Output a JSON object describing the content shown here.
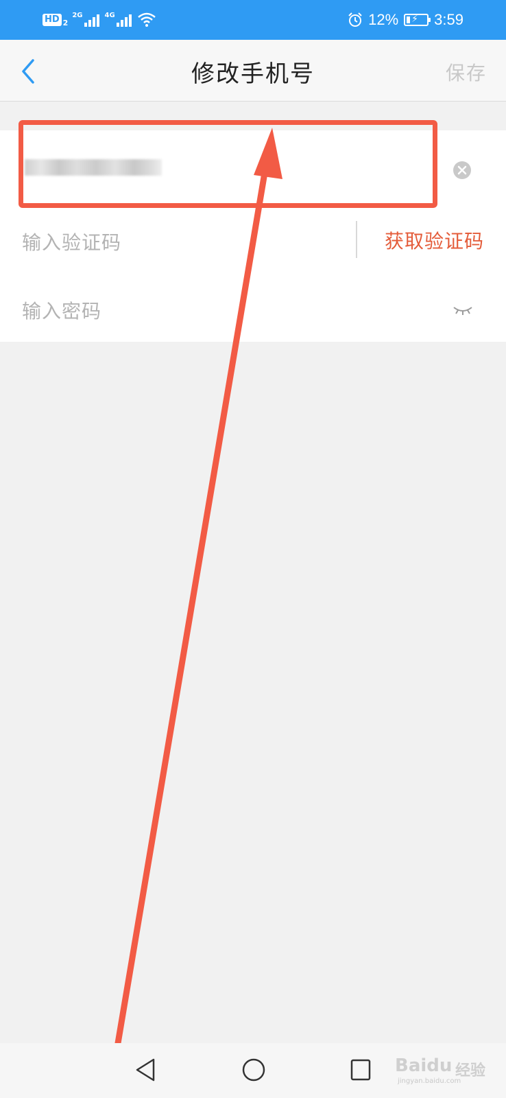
{
  "status_bar": {
    "hd_label": "HD",
    "hd_sub": "2",
    "net1_tag": "2G",
    "net2_tag": "4G",
    "battery_percent": "12%",
    "time": "3:59",
    "icons": [
      "signal-icon",
      "wifi-icon",
      "alarm-icon",
      "battery-charging-icon"
    ]
  },
  "header": {
    "title": "修改手机号",
    "save_label": "保存",
    "back_icon": "chevron-left-icon"
  },
  "form": {
    "phone_value": "",
    "code_placeholder": "输入验证码",
    "get_code_label": "获取验证码",
    "password_placeholder": "输入密码",
    "clear_icon": "clear-icon",
    "eye_icon": "eye-closed-icon"
  },
  "nav_bar": {
    "icons": [
      "nav-back-icon",
      "nav-home-icon",
      "nav-recent-icon"
    ]
  },
  "watermark": {
    "logo": "Baidu",
    "cn": "经验",
    "url": "jingyan.baidu.com"
  },
  "colors": {
    "status_bar": "#2f9bf3",
    "accent_blue": "#2f9bf3",
    "get_code": "#e45c3a",
    "annotation": "#f25b45"
  }
}
